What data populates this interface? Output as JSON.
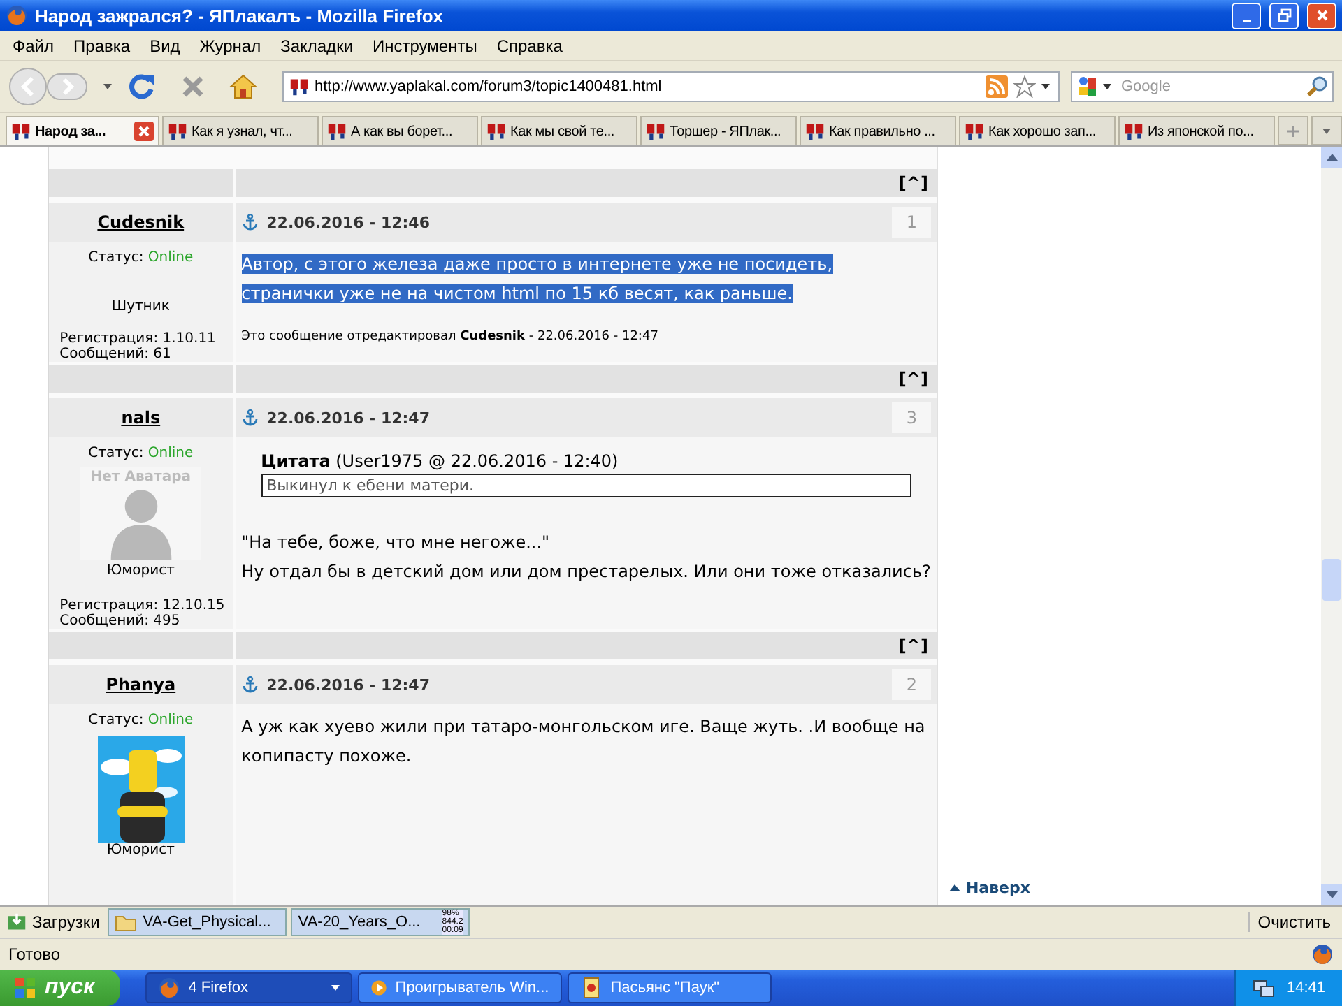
{
  "window": {
    "title": "Народ зажрался? - ЯПлакалъ - Mozilla Firefox"
  },
  "menu": [
    "Файл",
    "Правка",
    "Вид",
    "Журнал",
    "Закладки",
    "Инструменты",
    "Справка"
  ],
  "address": {
    "url": "http://www.yaplakal.com/forum3/topic1400481.html"
  },
  "search": {
    "placeholder": "Google"
  },
  "tabs": [
    {
      "label": "Народ за...",
      "selected": true
    },
    {
      "label": "Как я узнал, чт...",
      "selected": false
    },
    {
      "label": "А как вы борет...",
      "selected": false
    },
    {
      "label": "Как мы свой те...",
      "selected": false
    },
    {
      "label": "Торшер - ЯПлак...",
      "selected": false
    },
    {
      "label": "Как правильно ...",
      "selected": false
    },
    {
      "label": "Как хорошо зап...",
      "selected": false
    },
    {
      "label": "Из японской по...",
      "selected": false
    }
  ],
  "content": [
    {
      "kind": "bar",
      "link": "[^]"
    },
    {
      "kind": "post",
      "author": "Cudesnik",
      "date": "22.06.2016 - 12:46",
      "number": "1",
      "status_label": "Статус:",
      "status": "Online",
      "avatar": {
        "kind": "none"
      },
      "rank": "Шутник",
      "registration": "Регистрация: 1.10.11",
      "messages": "Сообщений: 61",
      "highlighted": true,
      "lines": [
        "Автор, с этого железа даже просто в интернете уже не посидеть,",
        "странички уже не на чистом html по 15 кб весят, как раньше."
      ],
      "edit_note": "Это сообщение отредактировал **Cudesnik** - 22.06.2016 - 12:47"
    },
    {
      "kind": "bar",
      "link": "[^]"
    },
    {
      "kind": "post",
      "author": "nals",
      "date": "22.06.2016 - 12:47",
      "number": "3",
      "status_label": "Статус:",
      "status": "Online",
      "avatar": {
        "kind": "placeholder",
        "caption": "Нет Аватара"
      },
      "rank": "Юморист",
      "registration": "Регистрация: 12.10.15",
      "messages": "Сообщений: 495",
      "highlighted": false,
      "quote": {
        "label": "Цитата",
        "source": "(User1975 @ 22.06.2016 - 12:40)",
        "text": "Выкинул к ебени матери."
      },
      "lines": [
        "\"На тебе, боже, что мне негоже...\"",
        "Ну отдал бы в детский дом или дом престарелых. Или они тоже отказались?"
      ]
    },
    {
      "kind": "bar",
      "link": "[^]"
    },
    {
      "kind": "post",
      "author": "Phanya",
      "date": "22.06.2016 - 12:47",
      "number": "2",
      "status_label": "Статус:",
      "status": "Online",
      "avatar": {
        "kind": "picture"
      },
      "rank": "Юморист",
      "highlighted": false,
      "lines": [
        "А уж как хуево жили при татаро-монгольском иге. Ваще жуть. .И вообще на",
        "копипасту похоже."
      ]
    }
  ],
  "side": {
    "top_link": "Наверх"
  },
  "downloads": {
    "label": "Загрузки",
    "items": [
      {
        "kind": "done",
        "name": "VA-Get_Physical..."
      },
      {
        "kind": "progress",
        "name": "VA-20_Years_O...",
        "info": [
          "98%",
          "844.2",
          "00:09"
        ]
      }
    ],
    "clear": "Очистить"
  },
  "status_bar": {
    "text": "Готово"
  },
  "taskbar": {
    "start": "пуск",
    "items": [
      {
        "kind": "firefox",
        "label": "4 Firefox",
        "selected": true
      },
      {
        "kind": "player",
        "label": "Проигрыватель Win...",
        "selected": false
      },
      {
        "kind": "cards",
        "label": "Пасьянс \"Паук\"",
        "selected": false
      }
    ],
    "clock": "14:41"
  }
}
